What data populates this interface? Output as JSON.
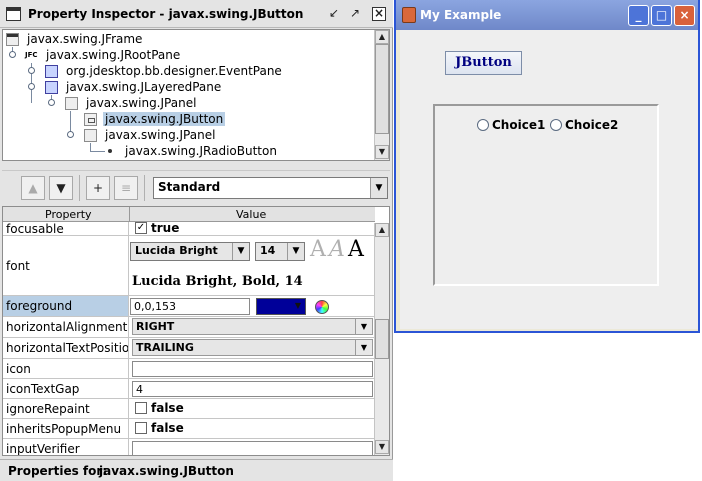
{
  "inspector": {
    "title": "Property Inspector - javax.swing.JButton",
    "tree": [
      {
        "label": "javax.swing.JFrame",
        "icon": "frame-icon"
      },
      {
        "label": "javax.swing.JRootPane",
        "icon": "jfc-icon",
        "icon_text": "JFC"
      },
      {
        "label": "org.jdesktop.bb.designer.EventPane",
        "icon": "layered-icon"
      },
      {
        "label": "javax.swing.JLayeredPane",
        "icon": "layered-icon"
      },
      {
        "label": "javax.swing.JPanel",
        "icon": "panel-icon"
      },
      {
        "label": "javax.swing.JButton",
        "icon": "button-icon",
        "selected": true
      },
      {
        "label": "javax.swing.JPanel",
        "icon": "panel-icon"
      },
      {
        "label": "javax.swing.JRadioButton",
        "icon": "radio-icon"
      }
    ],
    "toolbar": {
      "up_label": "▲",
      "down_label": "▼",
      "new_label": "+",
      "layout_label": "≡",
      "view_mode": "Standard"
    },
    "table": {
      "col_property": "Property",
      "col_value": "Value",
      "rows": {
        "focusable": {
          "name": "focusable",
          "value": "true",
          "checked": true
        },
        "font": {
          "name": "font",
          "family": "Lucida Bright",
          "size": "14",
          "preview_a": "A",
          "preview": "Lucida Bright, Bold, 14"
        },
        "foreground": {
          "name": "foreground",
          "value": "0,0,153",
          "color": "#000099"
        },
        "horizontalAlignment": {
          "name": "horizontalAlignment",
          "value": "RIGHT"
        },
        "horizontalTextPosition": {
          "name": "horizontalTextPosition",
          "value": "TRAILING"
        },
        "icon": {
          "name": "icon",
          "value": ""
        },
        "iconTextGap": {
          "name": "iconTextGap",
          "value": "4"
        },
        "ignoreRepaint": {
          "name": "ignoreRepaint",
          "value": "false",
          "checked": false
        },
        "inheritsPopupMenu": {
          "name": "inheritsPopupMenu",
          "value": "false",
          "checked": false
        },
        "inputVerifier": {
          "name": "inputVerifier",
          "value": ""
        }
      }
    },
    "status": {
      "label": "Properties for:",
      "value": "javax.swing.JButton"
    }
  },
  "example": {
    "title": "My Example",
    "button_label": "JButton",
    "choices": [
      "Choice1",
      "Choice2"
    ]
  },
  "colors": {
    "selection": "#b8cfe5",
    "foreground_value": "#000099",
    "title_blue": "#6f88c9",
    "close_red": "#d9613a"
  }
}
